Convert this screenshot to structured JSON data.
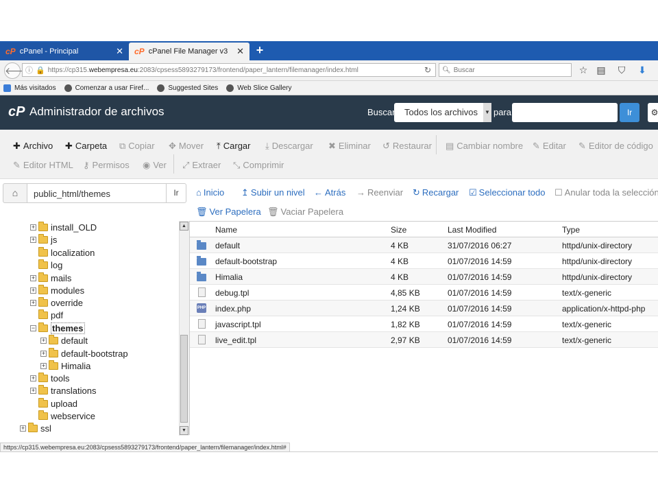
{
  "browser": {
    "tabs": [
      {
        "label": "cPanel - Principal",
        "icon": "cpanel-icon",
        "active": false
      },
      {
        "label": "cPanel File Manager v3",
        "icon": "cpanel-icon",
        "active": true
      }
    ],
    "new_tab": "+",
    "url": {
      "prefix": "https://cp315.",
      "host": "webempresa.eu",
      "rest": ":2083/cpsess5893279173/frontend/paper_lantern/filemanager/index.html"
    },
    "search_placeholder": "Buscar",
    "bookmarks": [
      {
        "label": "Más visitados",
        "color": "#3b7dd8"
      },
      {
        "label": "Comenzar a usar Firef...",
        "color": "#555555"
      },
      {
        "label": "Suggested Sites",
        "color": "#555555"
      },
      {
        "label": "Web Slice Gallery",
        "color": "#555555"
      }
    ],
    "status_url": "https://cp315.webempresa.eu:2083/cpsess5893279173/frontend/paper_lantern/filemanager/index.html#"
  },
  "header": {
    "logo": "cP",
    "title": "Administrador de archivos",
    "search_label": "Buscar",
    "search_scope": "Todos los archivos",
    "for_label": "para",
    "go_label": "Ir",
    "bg_color": "#293a4a",
    "accent": "#3d8fd8"
  },
  "toolbar": {
    "row1": [
      {
        "label": "Archivo",
        "glyph": "+",
        "enabled": true
      },
      {
        "label": "Carpeta",
        "glyph": "+",
        "enabled": true
      },
      {
        "label": "Copiar",
        "glyph": "⧉",
        "enabled": false
      },
      {
        "label": "Mover",
        "glyph": "✥",
        "enabled": false
      },
      {
        "label": "Cargar",
        "glyph": "⤒",
        "enabled": true
      },
      {
        "label": "Descargar",
        "glyph": "⤓",
        "enabled": false
      },
      {
        "label": "Eliminar",
        "glyph": "✖",
        "enabled": false
      },
      {
        "label": "Restaurar",
        "glyph": "↺",
        "enabled": false
      },
      {
        "label": "Cambiar nombre",
        "glyph": "▤",
        "enabled": false
      },
      {
        "label": "Editar",
        "glyph": "✎",
        "enabled": false
      },
      {
        "label": "Editor de código",
        "glyph": "✎",
        "enabled": false
      }
    ],
    "row2": [
      {
        "label": "Editor HTML",
        "glyph": "✎",
        "enabled": false
      },
      {
        "label": "Permisos",
        "glyph": "⚷",
        "enabled": false
      },
      {
        "label": "Ver",
        "glyph": "◉",
        "enabled": false
      },
      {
        "label": "Extraer",
        "glyph": "⤢",
        "enabled": false
      },
      {
        "label": "Comprimir",
        "glyph": "⤡",
        "enabled": false
      }
    ]
  },
  "pathbar": {
    "value": "public_html/themes",
    "go_label": "Ir"
  },
  "nav": {
    "row1": [
      {
        "label": "Inicio",
        "glyph": "⌂",
        "enabled": true
      },
      {
        "label": "Subir un nivel",
        "glyph": "↥",
        "enabled": true
      },
      {
        "label": "Atrás",
        "glyph": "←",
        "enabled": true
      },
      {
        "label": "Reenviar",
        "glyph": "→",
        "enabled": false
      },
      {
        "label": "Recargar",
        "glyph": "↻",
        "enabled": true
      },
      {
        "label": "Seleccionar todo",
        "glyph": "☑",
        "enabled": true
      },
      {
        "label": "Anular toda la selección",
        "glyph": "☐",
        "enabled": false
      }
    ],
    "row2": [
      {
        "label": "Ver Papelera",
        "glyph": "🗑",
        "enabled": true
      },
      {
        "label": "Vaciar Papelera",
        "glyph": "🗑",
        "enabled": false
      }
    ]
  },
  "tree": [
    {
      "label": "install_OLD",
      "expandable": true
    },
    {
      "label": "js",
      "expandable": true
    },
    {
      "label": "localization",
      "expandable": false
    },
    {
      "label": "log",
      "expandable": false
    },
    {
      "label": "mails",
      "expandable": true
    },
    {
      "label": "modules",
      "expandable": true
    },
    {
      "label": "override",
      "expandable": true
    },
    {
      "label": "pdf",
      "expandable": false
    },
    {
      "label": "themes",
      "expandable": true,
      "expanded": true,
      "selected": true
    },
    {
      "label": "default",
      "expandable": true,
      "child": true
    },
    {
      "label": "default-bootstrap",
      "expandable": true,
      "child": true
    },
    {
      "label": "Himalia",
      "expandable": true,
      "child": true
    },
    {
      "label": "tools",
      "expandable": true
    },
    {
      "label": "translations",
      "expandable": true
    },
    {
      "label": "upload",
      "expandable": false
    },
    {
      "label": "webservice",
      "expandable": false
    },
    {
      "label": "ssl",
      "expandable": true,
      "root": true
    }
  ],
  "files": {
    "columns": [
      "Name",
      "Size",
      "Last Modified",
      "Type"
    ],
    "rows": [
      {
        "name": "default",
        "size": "4 KB",
        "modified": "31/07/2016 06:27",
        "type": "httpd/unix-directory",
        "icon": "folder-icon"
      },
      {
        "name": "default-bootstrap",
        "size": "4 KB",
        "modified": "01/07/2016 14:59",
        "type": "httpd/unix-directory",
        "icon": "folder-icon"
      },
      {
        "name": "Himalia",
        "size": "4 KB",
        "modified": "01/07/2016 14:59",
        "type": "httpd/unix-directory",
        "icon": "folder-icon"
      },
      {
        "name": "debug.tpl",
        "size": "4,85 KB",
        "modified": "01/07/2016 14:59",
        "type": "text/x-generic",
        "icon": "text-file-icon"
      },
      {
        "name": "index.php",
        "size": "1,24 KB",
        "modified": "01/07/2016 14:59",
        "type": "application/x-httpd-php",
        "icon": "php-file-icon"
      },
      {
        "name": "javascript.tpl",
        "size": "1,82 KB",
        "modified": "01/07/2016 14:59",
        "type": "text/x-generic",
        "icon": "text-file-icon"
      },
      {
        "name": "live_edit.tpl",
        "size": "2,97 KB",
        "modified": "01/07/2016 14:59",
        "type": "text/x-generic",
        "icon": "text-file-icon"
      }
    ]
  }
}
